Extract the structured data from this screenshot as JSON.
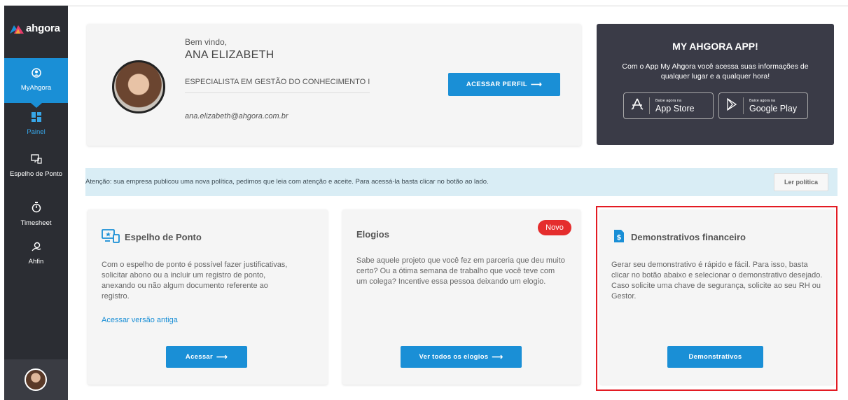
{
  "sidebar": {
    "logo": "ahgora",
    "items": [
      {
        "label": "MyAhgora",
        "icon": "user-circle-icon"
      },
      {
        "label": "Painel",
        "icon": "dashboard-icon"
      },
      {
        "label": "Espelho de Ponto",
        "icon": "time-mirror-icon"
      },
      {
        "label": "Timesheet",
        "icon": "stopwatch-icon"
      },
      {
        "label": "Ahfin",
        "icon": "ahfin-icon"
      }
    ],
    "accent": "#1a8fd6"
  },
  "profile": {
    "welcome": "Bem vindo,",
    "name": "ANA ELIZABETH",
    "role": "ESPECIALISTA EM GESTÃO DO CONHECIMENTO I",
    "email": "ana.elizabeth@ahgora.com.br",
    "button": "ACESSAR PERFIL"
  },
  "app": {
    "title": "MY AHGORA APP!",
    "description": "Com o App My Ahgora você acessa suas informações de qualquer lugar e a qualquer hora!",
    "apple_small": "Baixe agora na",
    "apple_big": "App Store",
    "google_small": "Baixe agora na",
    "google_big": "Google Play"
  },
  "notice": {
    "text": "Atenção: sua empresa publicou uma nova política, pedimos que leia com atenção e aceite. Para acessá-la basta clicar no botão ao lado.",
    "button": "Ler política"
  },
  "cards": {
    "espelho": {
      "title": "Espelho de Ponto",
      "description": "Com o espelho de ponto é possível fazer justificativas, solicitar abono ou a incluir um registro de ponto, anexando ou não algum documento referente ao registro.",
      "link": "Acessar versão antiga",
      "button": "Acessar"
    },
    "elogios": {
      "title": "Elogios",
      "badge": "Novo",
      "description": "Sabe aquele projeto que você fez em parceria que deu muito certo? Ou a ótima semana de trabalho que você teve com um colega? Incentive essa pessoa deixando um elogio.",
      "button": "Ver todos os elogios"
    },
    "demonstrativos": {
      "title": "Demonstrativos financeiro",
      "description": "Gerar seu demonstrativo é rápido e fácil. Para isso, basta clicar no botão abaixo e selecionar o demonstrativo desejado. Caso solicite uma chave de segurança, solicite ao seu RH ou Gestor.",
      "button": "Demonstrativos"
    }
  }
}
